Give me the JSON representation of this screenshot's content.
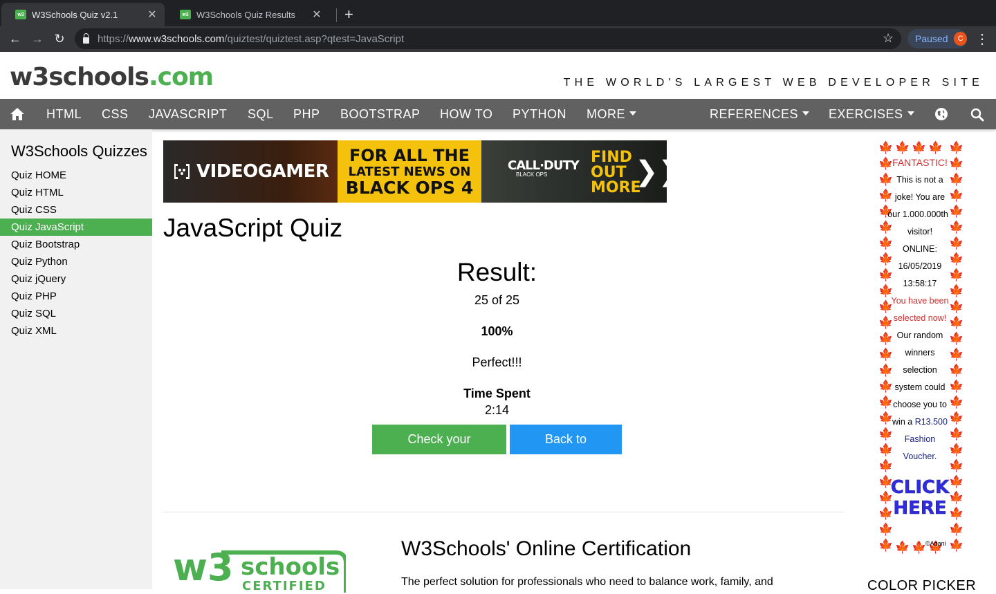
{
  "browser": {
    "tabs": [
      {
        "title": "W3Schools Quiz v2.1",
        "favicon_text": "w3"
      },
      {
        "title": "W3Schools Quiz Results",
        "favicon_text": "w3"
      }
    ],
    "new_tab": "+",
    "url_scheme": "https://",
    "url_host": "www.w3schools.com",
    "url_path": "/quiztest/quiztest.asp?qtest=JavaScript",
    "profile_status": "Paused",
    "profile_initial": "C"
  },
  "site": {
    "logo_main": "w3schools",
    "logo_tld": ".com",
    "tagline": "THE WORLD'S LARGEST WEB DEVELOPER SITE"
  },
  "topnav": {
    "items": [
      "HTML",
      "CSS",
      "JAVASCRIPT",
      "SQL",
      "PHP",
      "BOOTSTRAP",
      "HOW TO",
      "PYTHON",
      "MORE"
    ],
    "right_items": [
      "REFERENCES",
      "EXERCISES"
    ]
  },
  "sidebar": {
    "heading": "W3Schools Quizzes",
    "items": [
      "Quiz HOME",
      "Quiz HTML",
      "Quiz CSS",
      "Quiz JavaScript",
      "Quiz Bootstrap",
      "Quiz Python",
      "Quiz jQuery",
      "Quiz PHP",
      "Quiz SQL",
      "Quiz XML"
    ],
    "active_index": 3
  },
  "banner_ad": {
    "brand": "VIDEOGAMER",
    "line1": "FOR ALL THE",
    "line2": "LATEST NEWS ON",
    "line3": "BLACK OPS 4",
    "game": "CALL·DUTY",
    "game_sub": "BLACK OPS",
    "cta1": "FIND",
    "cta2": "OUT",
    "cta3": "MORE"
  },
  "quiz": {
    "title": "JavaScript Quiz",
    "result_heading": "Result:",
    "score": "25 of 25",
    "percent": "100%",
    "verdict": "Perfect!!!",
    "time_label": "Time Spent",
    "time_value": "2:14",
    "check_button": "Check your answers",
    "back_button": "Back to Quizzes"
  },
  "certification": {
    "logo_w3": "w3",
    "logo_schools": "schools",
    "logo_certified": "CERTIFIED",
    "title": "W3Schools' Online Certification",
    "description": "The perfect solution for professionals who need to balance work, family, and"
  },
  "side_ad": {
    "fantastic": "FANTASTIC!",
    "lines": [
      "This is not a",
      "joke! You are",
      "our 1.000.000th",
      "visitor!",
      "ONLINE:",
      "16/05/2019",
      "13:58:17"
    ],
    "red_lines": [
      "You have been",
      "selected now!"
    ],
    "lines2": [
      "Our random",
      "winners",
      "selection",
      "system could",
      "choose you to"
    ],
    "win_prefix": "win a ",
    "win_amount": "R13.500",
    "blue_lines": [
      "Fashion",
      "Voucher."
    ],
    "click": "CLICK",
    "here": "HERE",
    "copyright": "©Adani"
  },
  "color_picker": "COLOR PICKER",
  "colors": {
    "brand_green": "#4caf50",
    "nav_gray": "#616161",
    "button_blue": "#2196f3"
  }
}
